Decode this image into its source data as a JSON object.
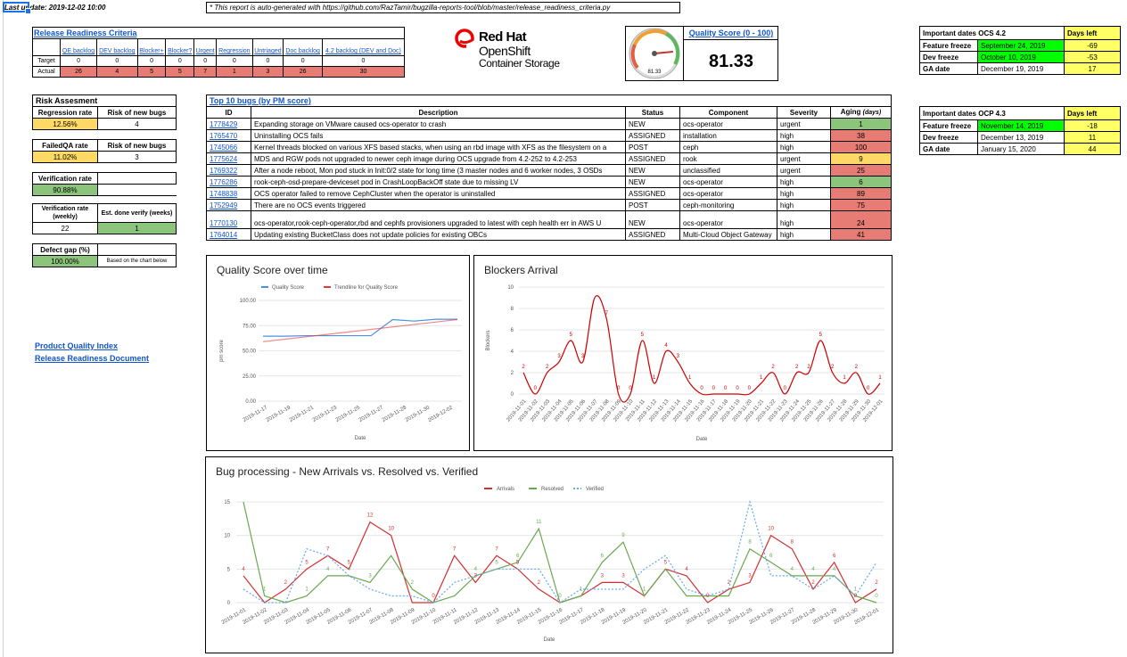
{
  "last_update": "Last update: 2019-12-02 10:00",
  "report_note": "* This report is auto-generated with https://github.com/RazTamir/bugzilla-reports-tool/blob/master/release_readiness_criteria.py",
  "release_readiness": {
    "title": "Release Readiness Criteria",
    "columns": [
      "QE backlog",
      "DEV backlog",
      "Blocker+",
      "Blocker?",
      "Urgent",
      "Regression",
      "Untriaged",
      "Doc backlog",
      "4.2 backlog (DEV and Doc)"
    ],
    "row_labels": [
      "Target",
      "Actual"
    ],
    "target": [
      "0",
      "0",
      "0",
      "0",
      "0",
      "0",
      "0",
      "0",
      "0"
    ],
    "actual": [
      "26",
      "4",
      "5",
      "5",
      "7",
      "1",
      "3",
      "26",
      "30"
    ]
  },
  "logo": {
    "line1": "Red Hat",
    "line2": "OpenShift",
    "line3": "Container Storage"
  },
  "quality_score": {
    "title": "Quality Score (0 - 100)",
    "value": "81.33",
    "gauge_label": "81.33",
    "gauge_fraction": 0.8133
  },
  "ocs_dates": {
    "title": "Important dates OCS 4.2",
    "days_header": "Days left",
    "rows": [
      {
        "label": "Feature freeze",
        "date": "September 24, 2019",
        "days": "-69"
      },
      {
        "label": "Dev freeze",
        "date": "October 10, 2019",
        "days": "-53"
      },
      {
        "label": "GA date",
        "date": "December 19, 2019",
        "days": "17"
      }
    ]
  },
  "ocp_dates": {
    "title": "Important dates OCP 4.3",
    "days_header": "Days left",
    "rows": [
      {
        "label": "Feature freeze",
        "date": "November 14, 2019",
        "days": "-18"
      },
      {
        "label": "Dev freeze",
        "date": "December 13, 2019",
        "days": "11"
      },
      {
        "label": "GA date",
        "date": "January 15, 2020",
        "days": "44"
      }
    ]
  },
  "risk": {
    "title": "Risk Assesment",
    "regression_rate_label": "Regression rate",
    "risk_new_bugs_label": "Risk of new bugs",
    "regression_rate": "12.56%",
    "regression_risk": "4",
    "failedqa_rate_label": "FailedQA rate",
    "risk_new_bugs_label2": "Risk of new bugs",
    "failedqa_rate": "11.02%",
    "failedqa_risk": "3",
    "verification_rate_label": "Verification rate",
    "verification_rate": "90.88%",
    "verification_weekly_label": "Verification rate (weekly)",
    "est_done_label": "Est. done verify (weeks)",
    "verification_weekly": "22",
    "est_done": "1",
    "defect_gap_label": "Defect gap (%)",
    "defect_gap": "100.00%",
    "defect_gap_note": "Based on the chart below"
  },
  "top_bugs": {
    "title": "Top 10 bugs (by PM score)",
    "headers": [
      "ID",
      "Description",
      "Status",
      "Component",
      "Severity",
      "Aging"
    ],
    "aging_suffix": "(days)",
    "rows": [
      {
        "id": "1778429",
        "desc": "Expanding storage on VMware caused ocs-operator to crash",
        "status": "NEW",
        "component": "ocs-operator",
        "severity": "urgent",
        "aging": "1",
        "color": "green"
      },
      {
        "id": "1765470",
        "desc": "Uninstalling OCS fails",
        "status": "ASSIGNED",
        "component": "installation",
        "severity": "high",
        "aging": "38",
        "color": "red"
      },
      {
        "id": "1745066",
        "desc": "Kernel threads blocked on various XFS based stacks, when using an rbd image with XFS as the filesystem on a",
        "status": "POST",
        "component": "ceph",
        "severity": "high",
        "aging": "100",
        "color": "red"
      },
      {
        "id": "1775624",
        "desc": "MDS and RGW pods not upgraded to newer ceph image during OCS upgrade from 4.2-252 to 4.2-253",
        "status": "ASSIGNED",
        "component": "rook",
        "severity": "urgent",
        "aging": "9",
        "color": "yellow"
      },
      {
        "id": "1769322",
        "desc": "After a node reboot, Mon pod stuck in Init:0/2 state for long time (3 master nodes and 6 worker nodes, 3 OSDs",
        "status": "NEW",
        "component": "unclassified",
        "severity": "urgent",
        "aging": "25",
        "color": "red"
      },
      {
        "id": "1776286",
        "desc": "rook-ceph-osd-prepare-deviceset pod in CrashLoopBackOff state due to missing LV",
        "status": "NEW",
        "component": "ocs-operator",
        "severity": "high",
        "aging": "6",
        "color": "green"
      },
      {
        "id": "1748838",
        "desc": "OCS operator failed to remove CephCluster when the operator is uninstalled",
        "status": "ASSIGNED",
        "component": "ocs-operator",
        "severity": "high",
        "aging": "89",
        "color": "red"
      },
      {
        "id": "1752949",
        "desc": "There are no OCS events triggered",
        "status": "POST",
        "component": "ceph-monitoring",
        "severity": "high",
        "aging": "75",
        "color": "red"
      },
      {
        "id": "1770130",
        "desc": "ocs-operator,rook-ceph-operator,rbd and cephfs  provisioners upgraded to latest  with ceph health err in AWS U",
        "status": "NEW",
        "component": "ocs-operator",
        "severity": "high",
        "aging": "24",
        "color": "red"
      },
      {
        "id": "1764014",
        "desc": "Updating existing BucketClass does not update policies for existing OBCs",
        "status": "ASSIGNED",
        "component": "Multi-Cloud Object Gateway",
        "severity": "high",
        "aging": "41",
        "color": "red"
      }
    ]
  },
  "links": {
    "product_quality_index": "Product Quality Index",
    "release_readiness_doc": "Release Readiness Document"
  },
  "chart_data": [
    {
      "type": "line",
      "title": "Quality Score over time",
      "xlabel": "Date",
      "ylabel": "pm score",
      "ylim": [
        0,
        100
      ],
      "y_ticks": [
        "0.00",
        "25.00",
        "50.00",
        "75.00",
        "100.00"
      ],
      "categories": [
        "2019-11-17",
        "2019-11-19",
        "2019-11-21",
        "2019-11-23",
        "2019-11-25",
        "2019-11-27",
        "2019-11-28",
        "2019-11-30",
        "2019-12-02"
      ],
      "series": [
        {
          "name": "Quality Score",
          "color": "#4a90e2",
          "values": [
            64.5,
            64.5,
            65,
            65,
            65,
            65,
            81,
            79.5,
            81.3,
            81.3
          ]
        },
        {
          "name": "Trendline for Quality Score",
          "color": "#e53935",
          "values": [
            59,
            81
          ]
        }
      ],
      "legend": "top"
    },
    {
      "type": "line",
      "title": "Blockers Arrival",
      "xlabel": "Date",
      "ylabel": "Blockers",
      "ylim": [
        0,
        10
      ],
      "y_ticks": [
        "0",
        "2",
        "4",
        "6",
        "8",
        "10"
      ],
      "categories": [
        "2019-11-01",
        "2019-11-02",
        "2019-11-03",
        "2019-11-04",
        "2019-11-05",
        "2019-11-06",
        "2019-11-07",
        "2019-11-08",
        "2019-11-09",
        "2019-11-10",
        "2019-11-11",
        "2019-11-12",
        "2019-11-13",
        "2019-11-14",
        "2019-11-15",
        "2019-11-16",
        "2019-11-17",
        "2019-11-18",
        "2019-11-19",
        "2019-11-20",
        "2019-11-21",
        "2019-11-22",
        "2019-11-23",
        "2019-11-24",
        "2019-11-25",
        "2019-11-26",
        "2019-11-27",
        "2019-11-28",
        "2019-11-29",
        "2019-11-30",
        "2019-12-01"
      ],
      "values": [
        2,
        0,
        2,
        3,
        5,
        3,
        9,
        7,
        0,
        0,
        5,
        1,
        4,
        3,
        1,
        0,
        0,
        0,
        0,
        0,
        1,
        2,
        0,
        2,
        2,
        5,
        2,
        1,
        2,
        0,
        1
      ],
      "point_labels": [
        "2",
        "0",
        "2",
        "3",
        "5",
        "3",
        "",
        "7",
        "0",
        "0",
        "5",
        "1",
        "4",
        "3",
        "1",
        "0",
        "0",
        "0",
        "0",
        "0",
        "1",
        "2",
        "0",
        "2",
        "2",
        "5",
        "2",
        "1",
        "2",
        "0",
        "1"
      ],
      "color": "#cc0000"
    },
    {
      "type": "line",
      "title": "Bug processing - New Arrivals vs. Resolved vs. Verified",
      "xlabel": "Date",
      "ylim": [
        0,
        15
      ],
      "y_ticks": [
        "0",
        "5",
        "10",
        "15"
      ],
      "categories": [
        "2019-11-01",
        "2019-11-02",
        "2019-11-03",
        "2019-11-04",
        "2019-11-05",
        "2019-11-06",
        "2019-11-07",
        "2019-11-08",
        "2019-11-09",
        "2019-11-10",
        "2019-11-11",
        "2019-11-12",
        "2019-11-13",
        "2019-11-14",
        "2019-11-15",
        "2019-11-16",
        "2019-11-17",
        "2019-11-18",
        "2019-11-19",
        "2019-11-20",
        "2019-11-21",
        "2019-11-22",
        "2019-11-23",
        "2019-11-24",
        "2019-11-25",
        "2019-11-26",
        "2019-11-27",
        "2019-11-28",
        "2019-11-29",
        "2019-11-30",
        "2019-12-01"
      ],
      "legend": "top",
      "series": [
        {
          "name": "Arrivals",
          "color": "#d32f2f",
          "style": "solid",
          "values": [
            4,
            0,
            2,
            5,
            7,
            5,
            12,
            10,
            0,
            0,
            7,
            3,
            7,
            5,
            2,
            0,
            1,
            3,
            3,
            1,
            5,
            4,
            0,
            2,
            3,
            10,
            8,
            2,
            6,
            0,
            2
          ]
        },
        {
          "name": "Resolved",
          "color": "#6aa84f",
          "style": "solid",
          "values": [
            15,
            1,
            0,
            1,
            4,
            4,
            3,
            7,
            2,
            0,
            1,
            4,
            5,
            6,
            11,
            0,
            1,
            6,
            9,
            1,
            5,
            1,
            1,
            1,
            8,
            6,
            4,
            4,
            4,
            1,
            0
          ]
        },
        {
          "name": "Verified",
          "color": "#64a8f0",
          "style": "dotted",
          "values": [
            2,
            0,
            0,
            8,
            7,
            4,
            2,
            1,
            1,
            0,
            3,
            4,
            5,
            5,
            5,
            0,
            2,
            2,
            2,
            5,
            7,
            2,
            1,
            2,
            15,
            4,
            4,
            2,
            4,
            1,
            6
          ]
        }
      ],
      "point_labels_arrivals": [
        "4",
        "",
        "2",
        "5",
        "7",
        "5",
        "12",
        "10",
        "",
        "0",
        "7",
        "3",
        "7",
        "5",
        "2",
        "",
        "",
        "3",
        "3",
        "",
        "5",
        "4",
        "0",
        "2",
        "3",
        "10",
        "8",
        "2",
        "6",
        "0",
        "2"
      ],
      "point_labels_resolved": [
        "",
        "1",
        "",
        "1",
        "4",
        "4",
        "3",
        "",
        "2",
        "",
        "",
        "4",
        "5",
        "6",
        "11",
        "0",
        "1",
        "6",
        "9",
        "1",
        "",
        "",
        "",
        "",
        "8",
        "6",
        "4",
        "4",
        "4",
        "1",
        "0"
      ]
    }
  ]
}
